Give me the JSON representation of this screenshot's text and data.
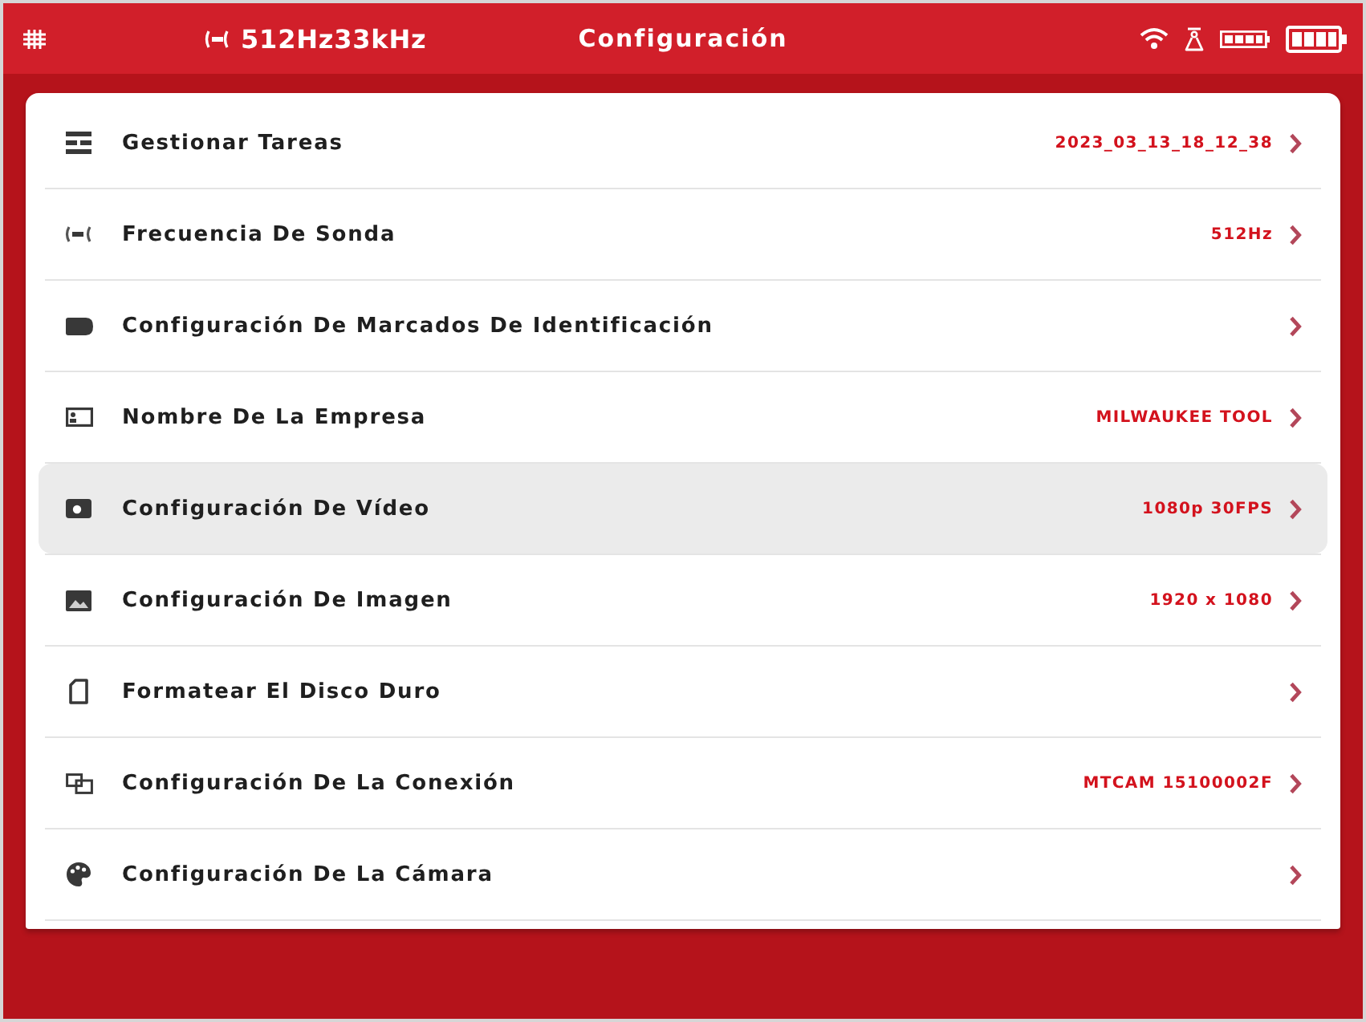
{
  "status_bar": {
    "frequency": "512Hz33kHz",
    "title": "Configuración"
  },
  "settings": [
    {
      "label": "Gestionar Tareas",
      "value": "2023_03_13_18_12_38",
      "selected": false
    },
    {
      "label": "Frecuencia De Sonda",
      "value": "512Hz",
      "selected": false
    },
    {
      "label": "Configuración De Marcados De Identificación",
      "selected": false
    },
    {
      "label": "Nombre De La Empresa",
      "value": "MILWAUKEE TOOL",
      "selected": false
    },
    {
      "label": "Configuración De Vídeo",
      "value": "1080p 30FPS",
      "selected": true
    },
    {
      "label": "Configuración De Imagen",
      "value": "1920 x 1080",
      "selected": false
    },
    {
      "label": "Formatear El Disco Duro",
      "selected": false
    },
    {
      "label": "Configuración De La Conexión",
      "value": "MTCAM 15100002F",
      "selected": false
    },
    {
      "label": "Configuración De La Cámara",
      "selected": false
    }
  ]
}
